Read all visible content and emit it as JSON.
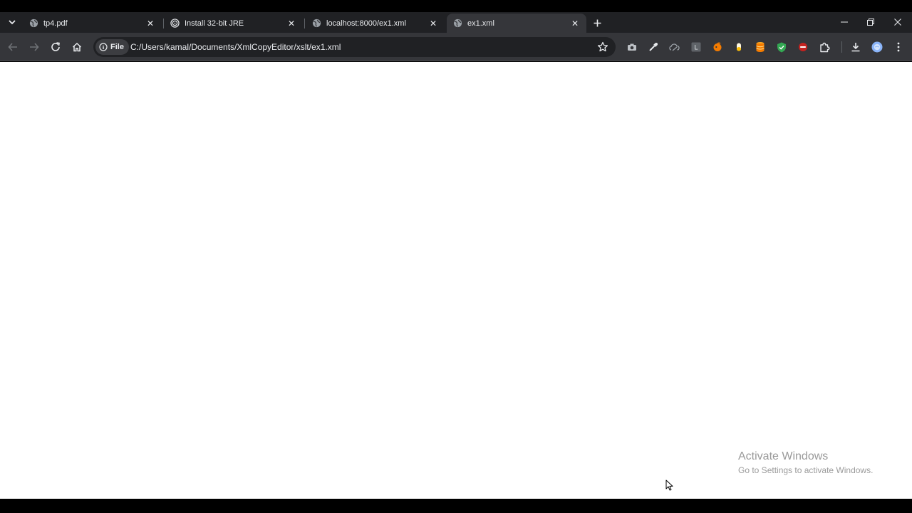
{
  "browser": {
    "tabs": [
      {
        "title": "tp4.pdf",
        "icon": "globe-icon",
        "active": false
      },
      {
        "title": "Install 32-bit JRE",
        "icon": "spiral-icon",
        "active": false
      },
      {
        "title": "localhost:8000/ex1.xml",
        "icon": "globe-icon",
        "active": false
      },
      {
        "title": "ex1.xml",
        "icon": "globe-icon",
        "active": true
      }
    ],
    "address": {
      "scheme_chip": "File",
      "url": "C:/Users/kamal/Documents/XmlCopyEditor/xslt/ex1.xml"
    },
    "extensions": [
      {
        "name": "camera-icon",
        "color": "#bdc1c6"
      },
      {
        "name": "eyedropper-icon",
        "color": "#e8eaed"
      },
      {
        "name": "cloud-link-icon",
        "color": "#9aa0a6"
      },
      {
        "name": "l-extension-icon",
        "color": "#9aa0a6",
        "label": "L"
      },
      {
        "name": "orange-extension-icon",
        "color": "#f57c00"
      },
      {
        "name": "pill-extension-icon",
        "color": "#fbbc04"
      },
      {
        "name": "database-extension-icon",
        "color": "#f57c00"
      },
      {
        "name": "shield-extension-icon",
        "color": "#34a853"
      },
      {
        "name": "blocker-extension-icon",
        "color": "#c5221f"
      },
      {
        "name": "puzzle-icon",
        "color": "#e8eaed"
      }
    ],
    "accent_color": "#8ab4f8"
  },
  "overlay": {
    "activate_title": "Activate Windows",
    "activate_subtitle": "Go to Settings to activate Windows."
  }
}
